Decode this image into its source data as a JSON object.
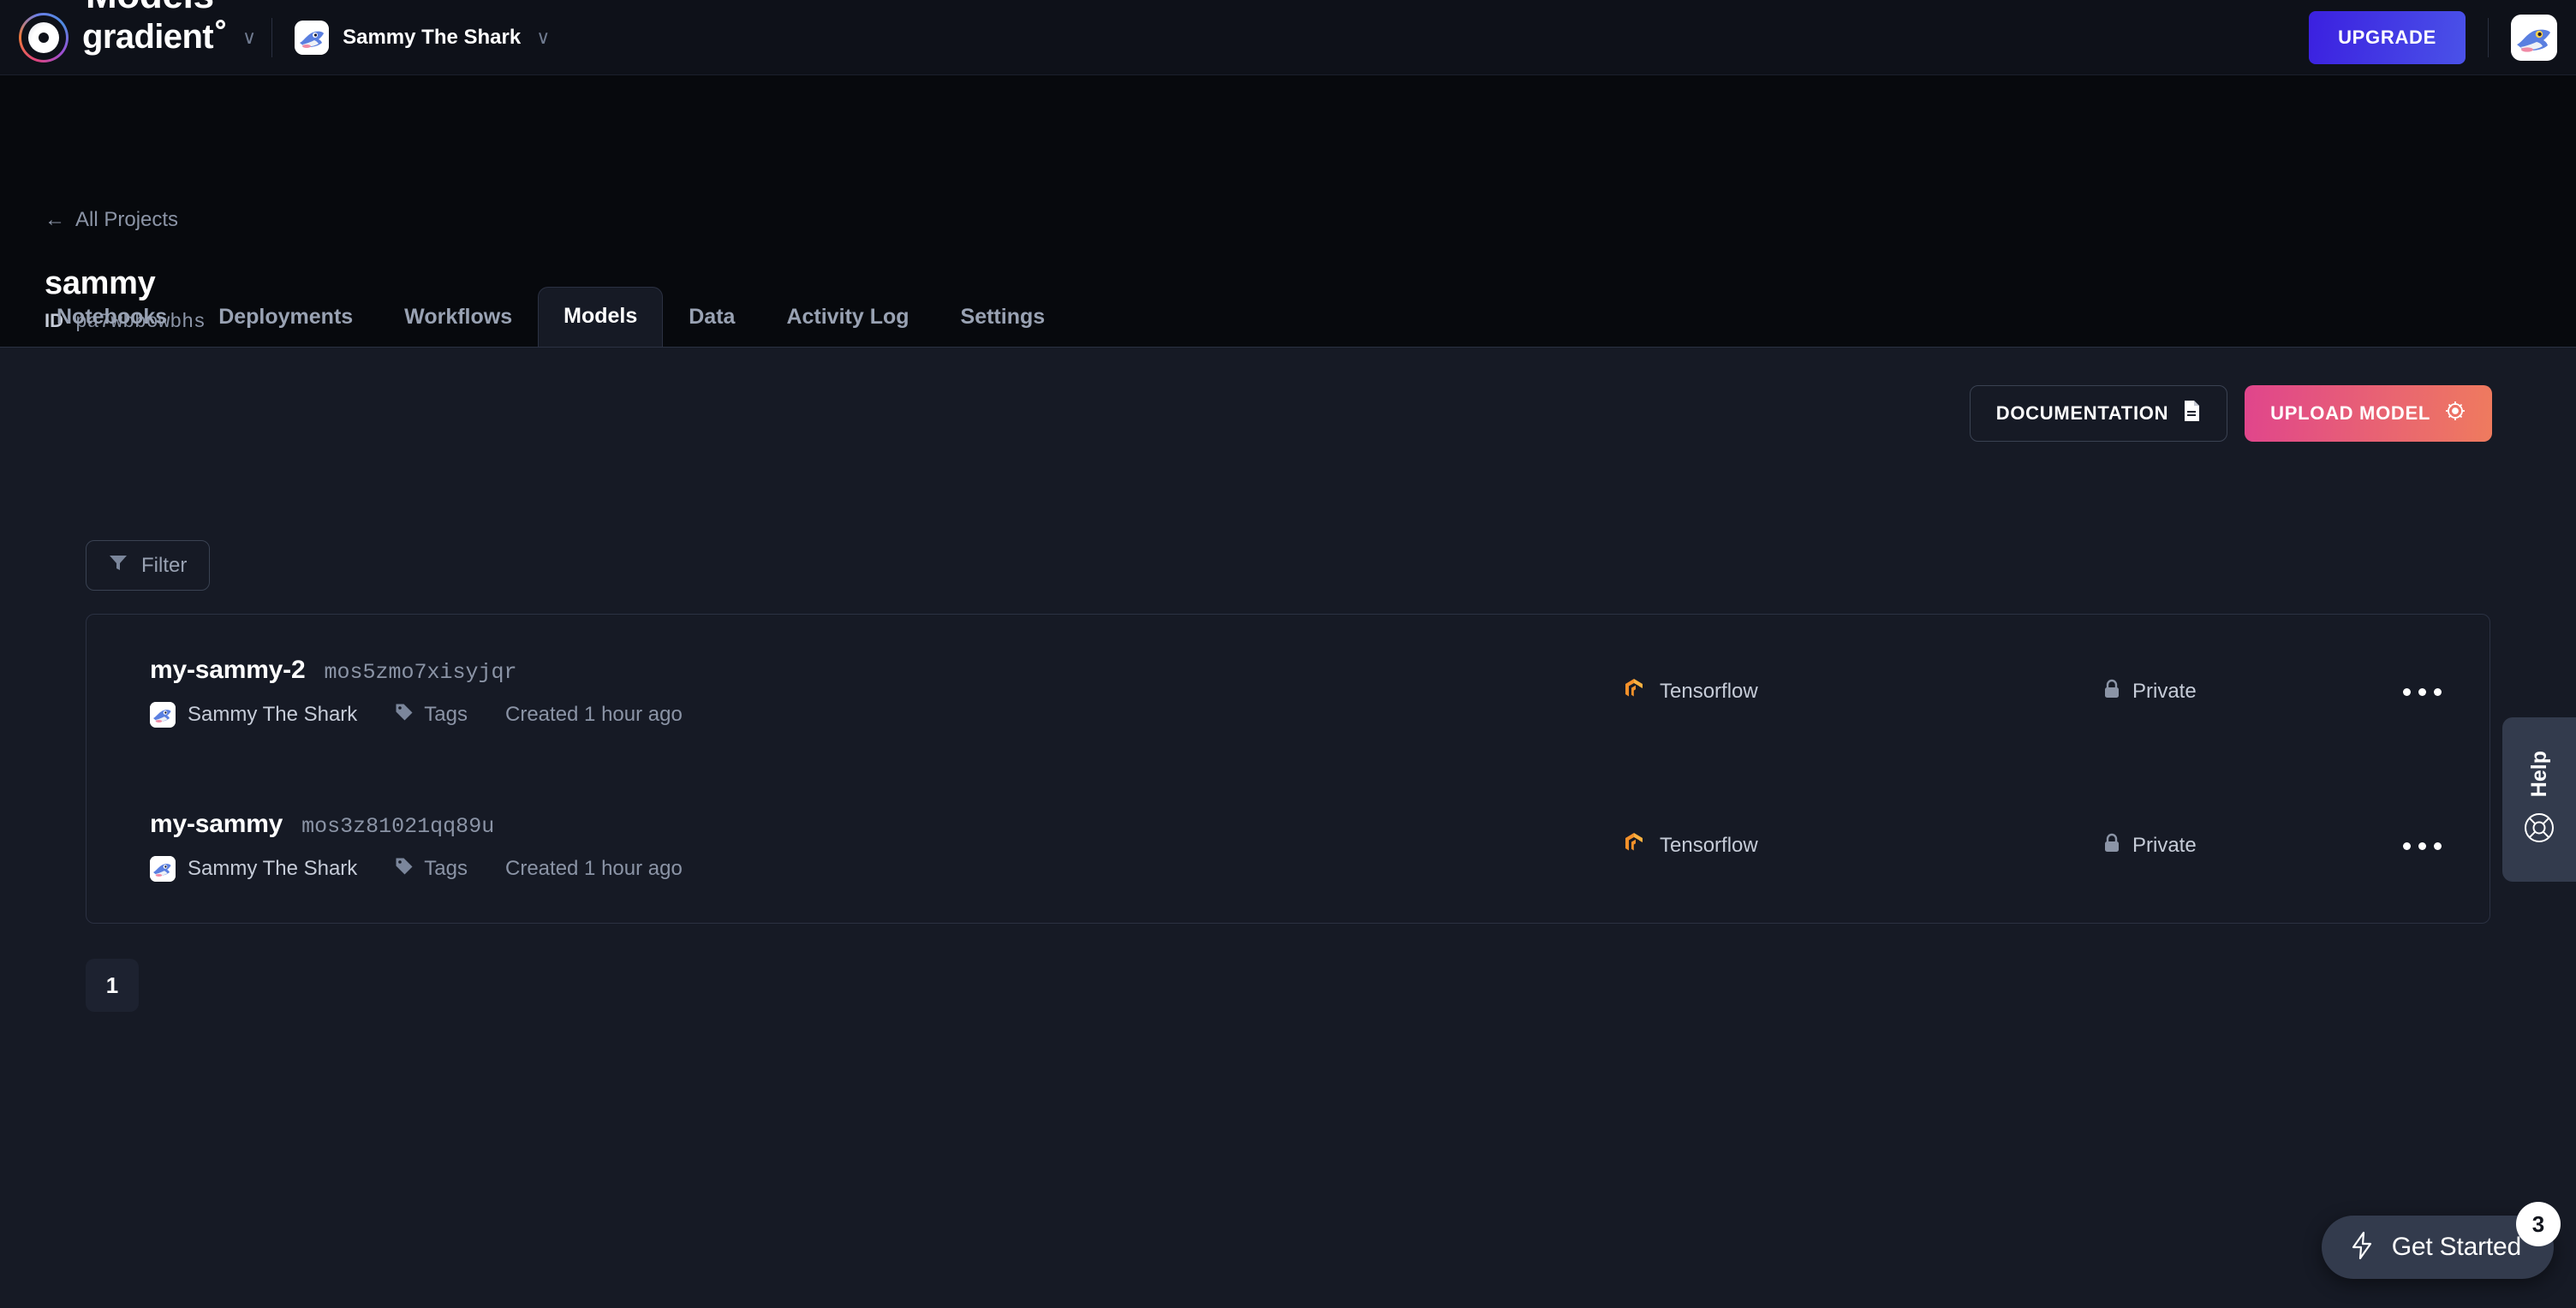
{
  "topnav": {
    "brand_name": "gradient",
    "brand_icon": "gradient-logo-icon",
    "brand_chevron": "∨",
    "team_name": "Sammy The Shark",
    "team_chevron": "∨",
    "upgrade_label": "UPGRADE",
    "upgrade_color": "#3b20e0"
  },
  "project": {
    "back_label": "All Projects",
    "back_arrow": "←",
    "name": "sammy",
    "id_label": "ID",
    "id_value": "pa7wbbowbhs"
  },
  "tabs": [
    {
      "label": "Notebooks",
      "active": false
    },
    {
      "label": "Deployments",
      "active": false
    },
    {
      "label": "Workflows",
      "active": false
    },
    {
      "label": "Models",
      "active": true
    },
    {
      "label": "Data",
      "active": false
    },
    {
      "label": "Activity Log",
      "active": false
    },
    {
      "label": "Settings",
      "active": false
    }
  ],
  "main": {
    "title": "Models",
    "documentation_label": "DOCUMENTATION",
    "upload_label": "UPLOAD MODEL",
    "upload_gradient_from": "#e0458c",
    "upload_gradient_to": "#ef7b5e",
    "filter_label": "Filter"
  },
  "models": [
    {
      "name": "my-sammy-2",
      "id": "mos5zmo7xisyjqr",
      "owner": "Sammy The Shark",
      "tags_label": "Tags",
      "created": "Created 1 hour ago",
      "framework": "Tensorflow",
      "visibility": "Private"
    },
    {
      "name": "my-sammy",
      "id": "mos3z81021qq89u",
      "owner": "Sammy The Shark",
      "tags_label": "Tags",
      "created": "Created 1 hour ago",
      "framework": "Tensorflow",
      "visibility": "Private"
    }
  ],
  "pagination": {
    "pages": [
      "1"
    ],
    "current": "1"
  },
  "help": {
    "label": "Help",
    "icon": "lifebuoy-icon"
  },
  "get_started": {
    "label": "Get Started",
    "badge": "3",
    "icon": "lightning-bolt-icon"
  }
}
